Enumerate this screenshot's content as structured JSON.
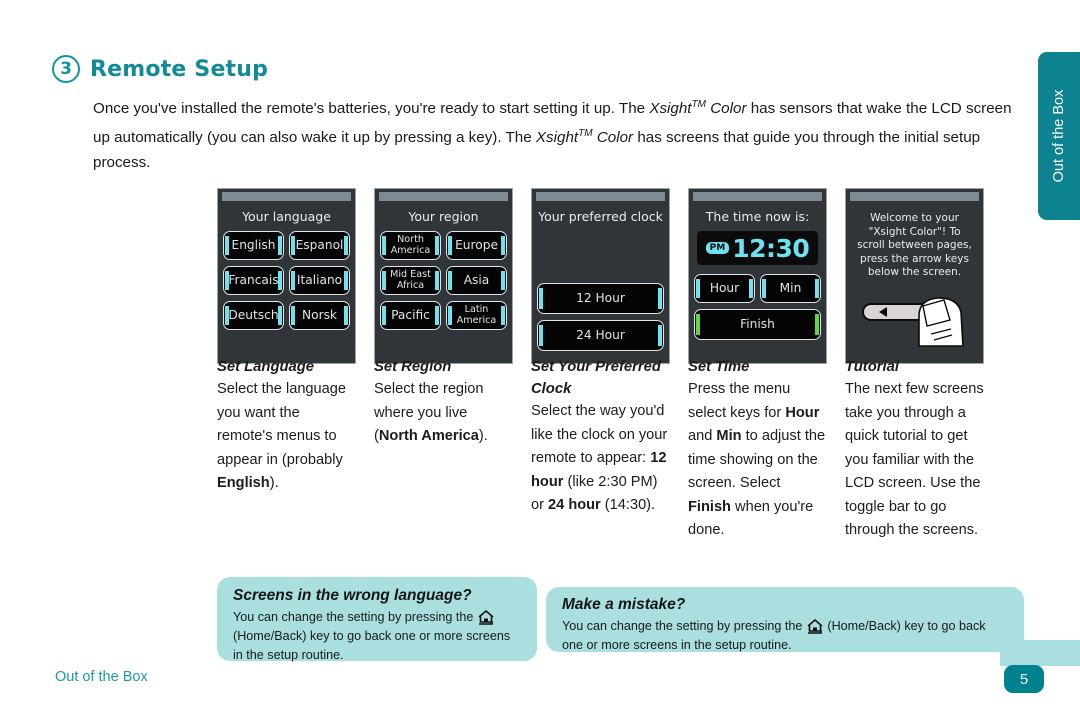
{
  "header": {
    "step_number": "3",
    "title": "Remote Setup"
  },
  "intro": {
    "part1": "Once you've installed the remote's batteries, you're ready to start setting it up. The ",
    "brand1": "Xsight",
    "tm1": "TM",
    "brand1b": " Color",
    "part2": " has sensors that wake the LCD screen up automatically (you can also wake it up by pressing a key). The ",
    "brand2": "Xsight",
    "tm2": "TM",
    "brand2b": " Color",
    "part3": " has screens that guide you through the initial setup process."
  },
  "screens": [
    {
      "title": "Your language",
      "buttons": [
        [
          "English",
          "Espanol"
        ],
        [
          "Francais",
          "Italiano"
        ],
        [
          "Deutsch",
          "Norsk"
        ]
      ]
    },
    {
      "title": "Your region",
      "buttons": [
        [
          "North America",
          "Europe"
        ],
        [
          "Mid East Africa",
          "Asia"
        ],
        [
          "Pacific",
          "Latin America"
        ]
      ]
    },
    {
      "title": "Your preferred clock",
      "buttons": [
        "12 Hour",
        "24 Hour"
      ]
    },
    {
      "title": "The time now is:",
      "time_meridiem": "PM",
      "time_value": "12:30",
      "buttons_row": [
        "Hour",
        "Min"
      ],
      "finish_button": "Finish"
    },
    {
      "title": "Welcome to your \"Xsight Color\"! To scroll between pages, press the arrow keys below the screen."
    }
  ],
  "captions": [
    {
      "head": "Set Language",
      "body_a": "Select the language you want the remote's menus to appear in (probably ",
      "bold": "English",
      "body_b": ")."
    },
    {
      "head": "Set Region",
      "body_a": "Select the region where you live (",
      "bold": "North America",
      "body_b": ")."
    },
    {
      "head": "Set Your Preferred Clock",
      "body_a": "Select the way you'd like the clock on your remote to appear: ",
      "bold": "12 hour",
      "body_b": " (like 2:30 PM) or ",
      "bold2": "24 hour",
      "body_c": " (14:30)."
    },
    {
      "head": "Set Time",
      "body_a": "Press the menu select keys for ",
      "bold": "Hour",
      "body_b": " and ",
      "bold2": "Min",
      "body_c": " to adjust the time showing on the screen. Select ",
      "bold3": "Finish",
      "body_d": " when you're done."
    },
    {
      "head": "Tutorial",
      "body_a": "The next few screens take you through a quick tutorial to get you familiar with the LCD screen. Use the toggle bar to go through the screens."
    }
  ],
  "callouts": {
    "left": {
      "title": "Screens in the wrong language?",
      "body_a": "You can change the setting by pressing the ",
      "body_b": " (Home/Back) key to go back one or more screens in the setup routine."
    },
    "right": {
      "title": "Make a mistake?",
      "body_a": "You can change the setting by pressing the ",
      "body_b": " (Home/Back) key to go back one or more screens in the setup routine."
    }
  },
  "side_tab": {
    "label": "Out of the Box"
  },
  "footer": {
    "label": "Out of the Box",
    "page_number": "5"
  },
  "colors": {
    "accent_teal": "#128a98",
    "tab_teal": "#0d8290",
    "callout_bg": "#aadfdf",
    "lcd_cyan": "#6ee3ef",
    "lcd_green": "#5ed83c",
    "screen_bg": "#2f3538"
  }
}
